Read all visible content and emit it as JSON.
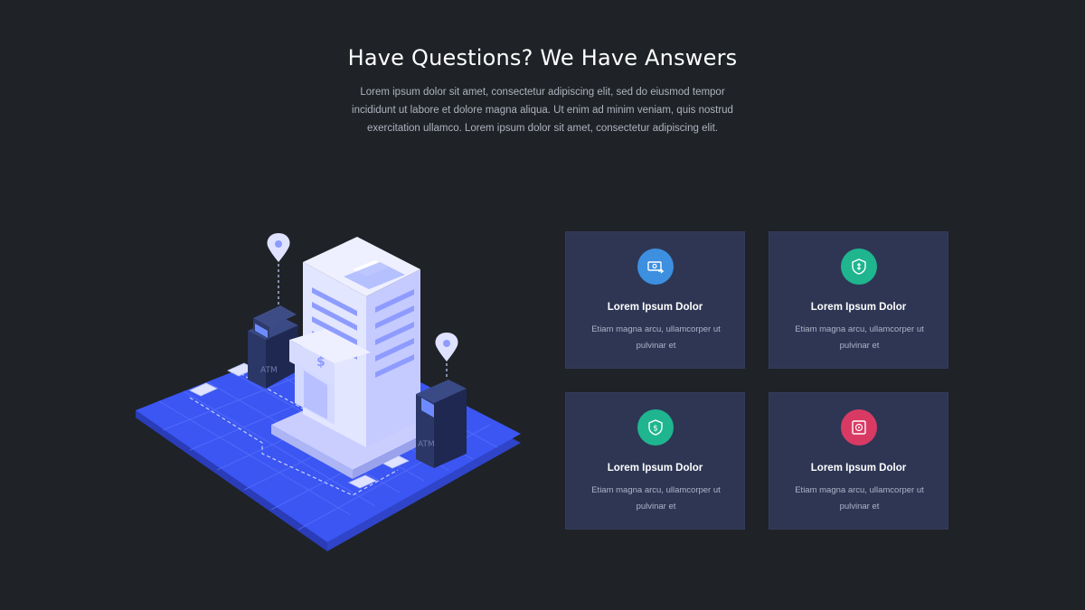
{
  "header": {
    "title": "Have Questions? We Have Answers",
    "description": "Lorem ipsum dolor sit amet, consectetur adipiscing elit, sed do eiusmod tempor incididunt ut labore et dolore magna aliqua. Ut enim ad minim veniam, quis nostrud exercitation ullamco. Lorem ipsum dolor sit amet, consectetur adipiscing elit."
  },
  "illustration": {
    "atm_label": "ATM",
    "currency_symbol": "$"
  },
  "cards": [
    {
      "icon": "money-transfer-icon",
      "color": "#3d8fe0",
      "title": "Lorem Ipsum Dolor",
      "text": "Etiam magna arcu, ullamcorper ut pulvinar et"
    },
    {
      "icon": "shield-icon",
      "color": "#1fb58f",
      "title": "Lorem Ipsum Dolor",
      "text": "Etiam magna arcu, ullamcorper ut pulvinar et"
    },
    {
      "icon": "shield-dollar-icon",
      "color": "#1fb58f",
      "title": "Lorem Ipsum Dolor",
      "text": "Etiam magna arcu, ullamcorper ut pulvinar et"
    },
    {
      "icon": "safe-icon",
      "color": "#d93a64",
      "title": "Lorem Ipsum Dolor",
      "text": "Etiam magna arcu, ullamcorper ut pulvinar et"
    }
  ],
  "colors": {
    "background": "#1f2227",
    "card_background": "#2e3654",
    "platform": "#3d55f0",
    "building": "#dfe3ff"
  }
}
